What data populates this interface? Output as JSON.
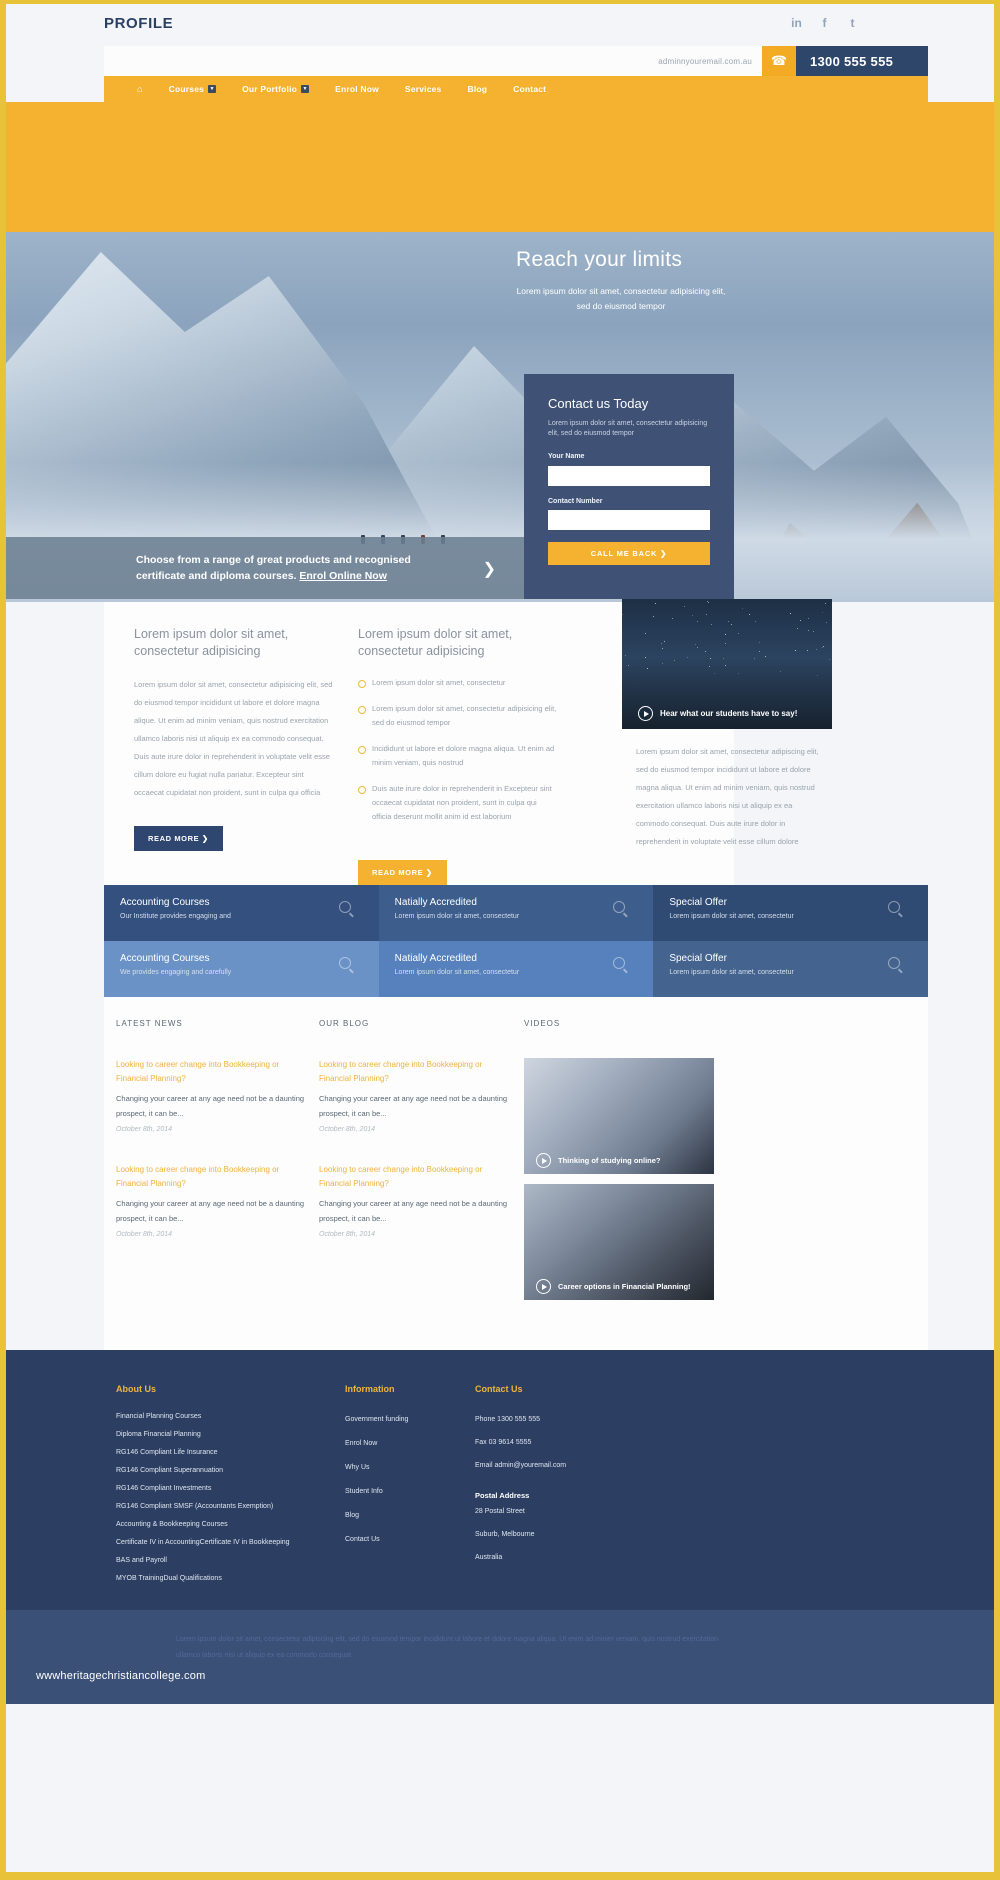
{
  "frame": {
    "accent_yellow": "#e8c33a",
    "brand_yellow": "#f5b230",
    "brand_navy": "#2f466b"
  },
  "topbar": {
    "brand": "PROFILE",
    "social": [
      {
        "name": "linkedin-icon",
        "glyph": "in"
      },
      {
        "name": "facebook-icon",
        "glyph": "f"
      },
      {
        "name": "twitter-icon",
        "glyph": "t"
      }
    ]
  },
  "strip": {
    "email": "adminnyouremail.com.au",
    "phone_icon": "☎",
    "phone": "1300 555 555"
  },
  "nav": {
    "home_icon": "⌂",
    "items": [
      {
        "label": "Courses",
        "caret": "▼"
      },
      {
        "label": "Our Portfolio",
        "caret": "▼"
      },
      {
        "label": "Enrol Now",
        "caret": ""
      },
      {
        "label": "Services",
        "caret": ""
      },
      {
        "label": "Blog",
        "caret": ""
      },
      {
        "label": "Contact",
        "caret": ""
      }
    ]
  },
  "hero": {
    "title": "Reach your limits",
    "subtitle": "Lorem ipsum dolor sit amet, consectetur adipisicing elit, sed do eiusmod tempor"
  },
  "contact_card": {
    "title": "Contact us Today",
    "subtitle": "Lorem ipsum dolor sit amet, consectetur adipisicing elit, sed do eiusmod tempor",
    "name_label": "Your Name",
    "name_value": "",
    "name_placeholder": "",
    "number_label": "Contact Number",
    "number_value": "",
    "number_placeholder": "",
    "button": "CALL ME BACK  ❯"
  },
  "callout": {
    "line1": "Choose from a range of great products and recognised",
    "line2": "certificate and diploma courses.",
    "link": "Enrol Online Now",
    "arrow": "❯"
  },
  "main": {
    "left": {
      "heading": "Lorem ipsum dolor sit amet, consectetur adipisicing",
      "body": "Lorem ipsum dolor sit amet, consectetur adipisicing elit, sed do eiusmod tempor incididunt ut labore et dolore magna alique. Ut enim ad minim veniam, quis nostrud exercitation ullamco laboris nisi ut aliquip ex ea commodo consequat. Duis aute irure dolor in reprehenderit in voluptate velit esse cillum dolore eu fugiat nulla pariatur. Excepteur sint occaecat cupidatat non proident, sunt in culpa qui officia",
      "button": "READ MORE  ❯"
    },
    "middle": {
      "heading": "Lorem ipsum dolor sit amet, consectetur adipisicing",
      "bullets": [
        "Lorem ipsum dolor sit amet, consectetur",
        "Lorem ipsum dolor sit amet, consectetur adipisicing elit, sed do eiusmod tempor",
        "Incididunt ut labore et dolore magna aliqua. Ut enim ad minim veniam, quis nostrud",
        "Duis aute irure dolor in reprehenderit in Excepteur sint occaecat cupidatat non proident, sunt in culpa qui officia deserunt mollit anim id est laborium"
      ],
      "button": "READ MORE  ❯"
    },
    "right": {
      "video_caption": "Hear what our students have to say!",
      "body": "Lorem ipsum dolor sit amet, consectetur adipiscing elit, sed do eiusmod tempor incididunt ut labore et dolore magna aliqua. Ut enim ad minim veniam, quis nostrud exercitation ullamco laboris nisi ut aliquip ex ea commodo consequat. Duis aute irure dolor in reprehenderit in voluptate velit esse cillum dolore"
    }
  },
  "tiles": [
    {
      "title": "Accounting Courses",
      "desc": "Our Institute provides engaging and",
      "shade": "t-dark"
    },
    {
      "title": "Natially Accredited",
      "desc": "Lorem ipsum dolor sit amet, consectetur",
      "shade": "t-mid"
    },
    {
      "title": "Special Offer",
      "desc": "Lorem ipsum dolor sit amet, consectetur",
      "shade": "t-dark2"
    },
    {
      "title": "Accounting Courses",
      "desc": "We provides engaging and carefully",
      "shade": "t-l2"
    },
    {
      "title": "Natially Accredited",
      "desc": "Lorem ipsum dolor sit amet, consectetur",
      "shade": "t-light"
    },
    {
      "title": "Special Offer",
      "desc": "Lorem ipsum dolor sit amet, consectetur",
      "shade": "t-d3"
    }
  ],
  "news": {
    "col1_head": "LATEST NEWS",
    "col2_head": "OUR BLOG",
    "col3_head": "VIDEOS",
    "items_col1": [
      {
        "title": "Looking to career change into Bookkeeping or Financial Planning?",
        "excerpt": "Changing your career at any age need not be a daunting prospect, it can be...",
        "date": "October 8th, 2014"
      },
      {
        "title": "Looking to career change into Bookkeeping or Financial Planning?",
        "excerpt": "Changing your career at any age need not be a daunting prospect, it can be...",
        "date": "October 8th, 2014"
      }
    ],
    "items_col2": [
      {
        "title": "Looking to career change into Bookkeeping or Financial Planning?",
        "excerpt": "Changing your career at any age need not be a daunting prospect, it can be...",
        "date": "October 8th, 2014"
      },
      {
        "title": "Looking to career change into Bookkeeping or Financial Planning?",
        "excerpt": "Changing your career at any age need not be a daunting prospect, it can be...",
        "date": "October 8th, 2014"
      }
    ],
    "videos": [
      {
        "caption": "Thinking of studying online?"
      },
      {
        "caption": "Career options in Financial Planning!"
      }
    ]
  },
  "footer": {
    "about": {
      "head": "About Us",
      "links": [
        "Financial Planning Courses",
        "Diploma Financial Planning",
        "RG146 Compliant Life Insurance",
        "RG146 Compliant Superannuation",
        "RG146 Compliant Investments",
        "RG146 Compliant SMSF (Accountants Exemption)",
        "Accounting & Bookkeeping Courses",
        "Certificate IV in AccountingCertificate IV in Bookkeeping",
        "BAS and Payroll",
        "MYOB TrainingDual Qualifications"
      ]
    },
    "information": {
      "head": "Information",
      "links": [
        "Government funding",
        "Enrol Now",
        "Why Us",
        "Student Info",
        "Blog",
        "Contact Us"
      ]
    },
    "contact": {
      "head": "Contact Us",
      "lines": [
        "Phone 1300 555 555",
        "Fax 03 9614 5555",
        "Email admin@youremail.com"
      ],
      "postal_head": "Postal Address",
      "postal": [
        "28 Postal Street",
        "Suburb, Melbourne",
        "Australia"
      ]
    },
    "phone_icon": "☎",
    "phone": "1300 555 555",
    "legal": "Lorem ipsum dolor sit amet, consectetur adipiscing elit, sed do eiusmod tempor incididunt ut labore et dolore magna aliqua. Ut enim ad minim veniam, quis nostrud exercitation ullamco laboris nisi ut aliquip ex ea commodo consequat.",
    "watermark": "wwwheritagechristiancollege.com"
  }
}
